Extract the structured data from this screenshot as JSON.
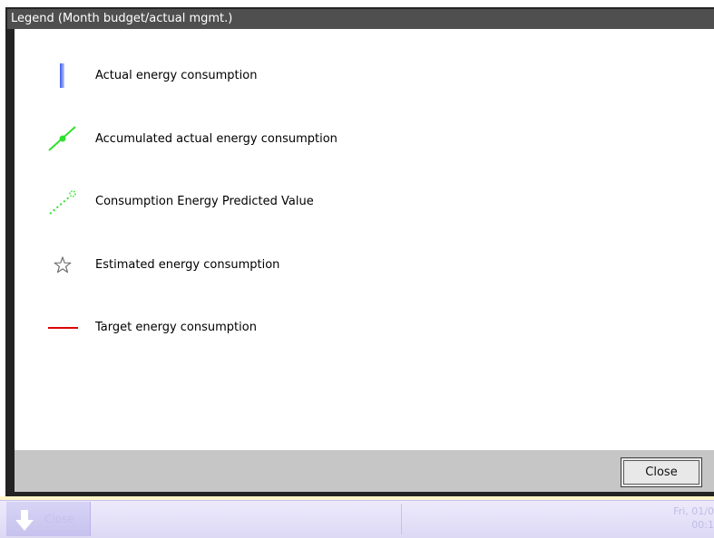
{
  "dialog": {
    "title": "Legend (Month budget/actual mgmt.)",
    "close_button_label": "Close"
  },
  "legend": {
    "items": [
      {
        "label": "Actual energy consumption",
        "icon": "actual-bar-icon",
        "color": "#5b7df0"
      },
      {
        "label": "Accumulated actual energy consumption",
        "icon": "accumulated-line-icon",
        "color": "#2fe12f"
      },
      {
        "label": "Consumption Energy Predicted Value",
        "icon": "predicted-dotted-line-icon",
        "color": "#2fe12f"
      },
      {
        "label": "Estimated energy consumption",
        "icon": "star-icon",
        "color": "#7a7a7a"
      },
      {
        "label": "Target energy consumption",
        "icon": "target-line-icon",
        "color": "#dd0000"
      }
    ]
  },
  "taskbar": {
    "close_label": "Close",
    "clock_date": "Fri, 01/0",
    "clock_time": "00:1"
  }
}
